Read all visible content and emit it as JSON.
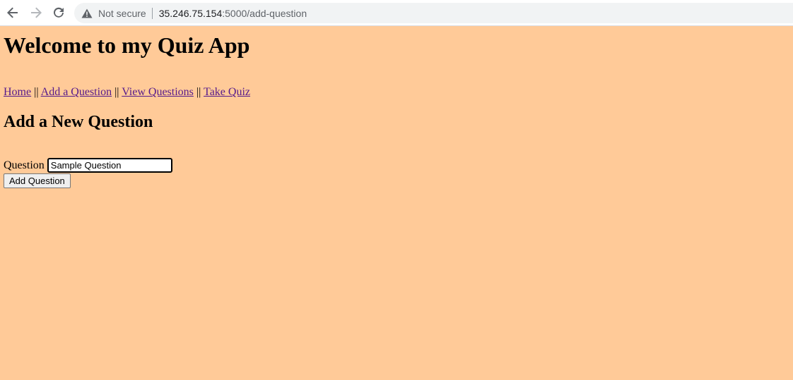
{
  "browser": {
    "security_label": "Not secure",
    "url_host": "35.246.75.154",
    "url_path": ":5000/add-question"
  },
  "header": {
    "title": "Welcome to my Quiz App"
  },
  "nav": {
    "home": "Home",
    "add_question": "Add a Question",
    "view_questions": "View Questions",
    "take_quiz": "Take Quiz",
    "separator": " || "
  },
  "form": {
    "heading": "Add a New Question",
    "question_label": "Question",
    "question_value": "Sample Question",
    "submit_label": "Add Question"
  },
  "colors": {
    "page_background": "#ffca98",
    "visited_link": "#551a8b"
  }
}
